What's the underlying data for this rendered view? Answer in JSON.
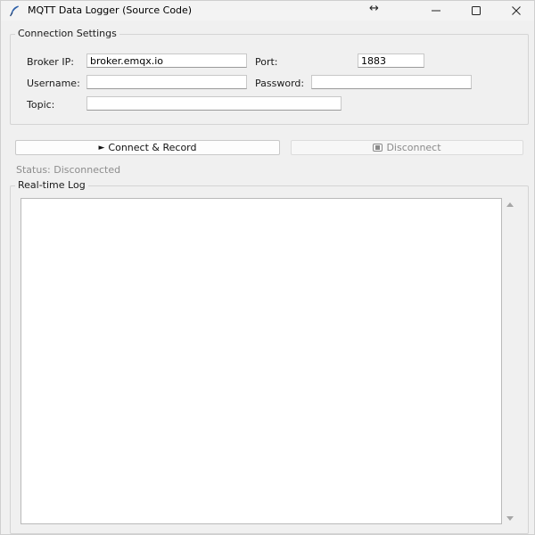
{
  "window": {
    "title": "MQTT Data Logger (Source Code)",
    "app_icon": "feather-icon",
    "controls": [
      "resize-arrows-icon",
      "minimize-icon",
      "maximize-icon",
      "close-icon"
    ]
  },
  "connection": {
    "frame_title": "Connection Settings",
    "broker_label": "Broker IP:",
    "broker_value": "broker.emqx.io",
    "port_label": "Port:",
    "port_value": "1883",
    "username_label": "Username:",
    "username_value": "",
    "password_label": "Password:",
    "password_value": "",
    "topic_label": "Topic:",
    "topic_value": ""
  },
  "actions": {
    "connect_label": "Connect & Record",
    "connect_icon": "play-icon",
    "disconnect_label": "Disconnect",
    "disconnect_icon": "stop-icon"
  },
  "status": {
    "text": "Status: Disconnected",
    "color": "#8d8d8d"
  },
  "log": {
    "frame_title": "Real-time Log",
    "content": ""
  }
}
